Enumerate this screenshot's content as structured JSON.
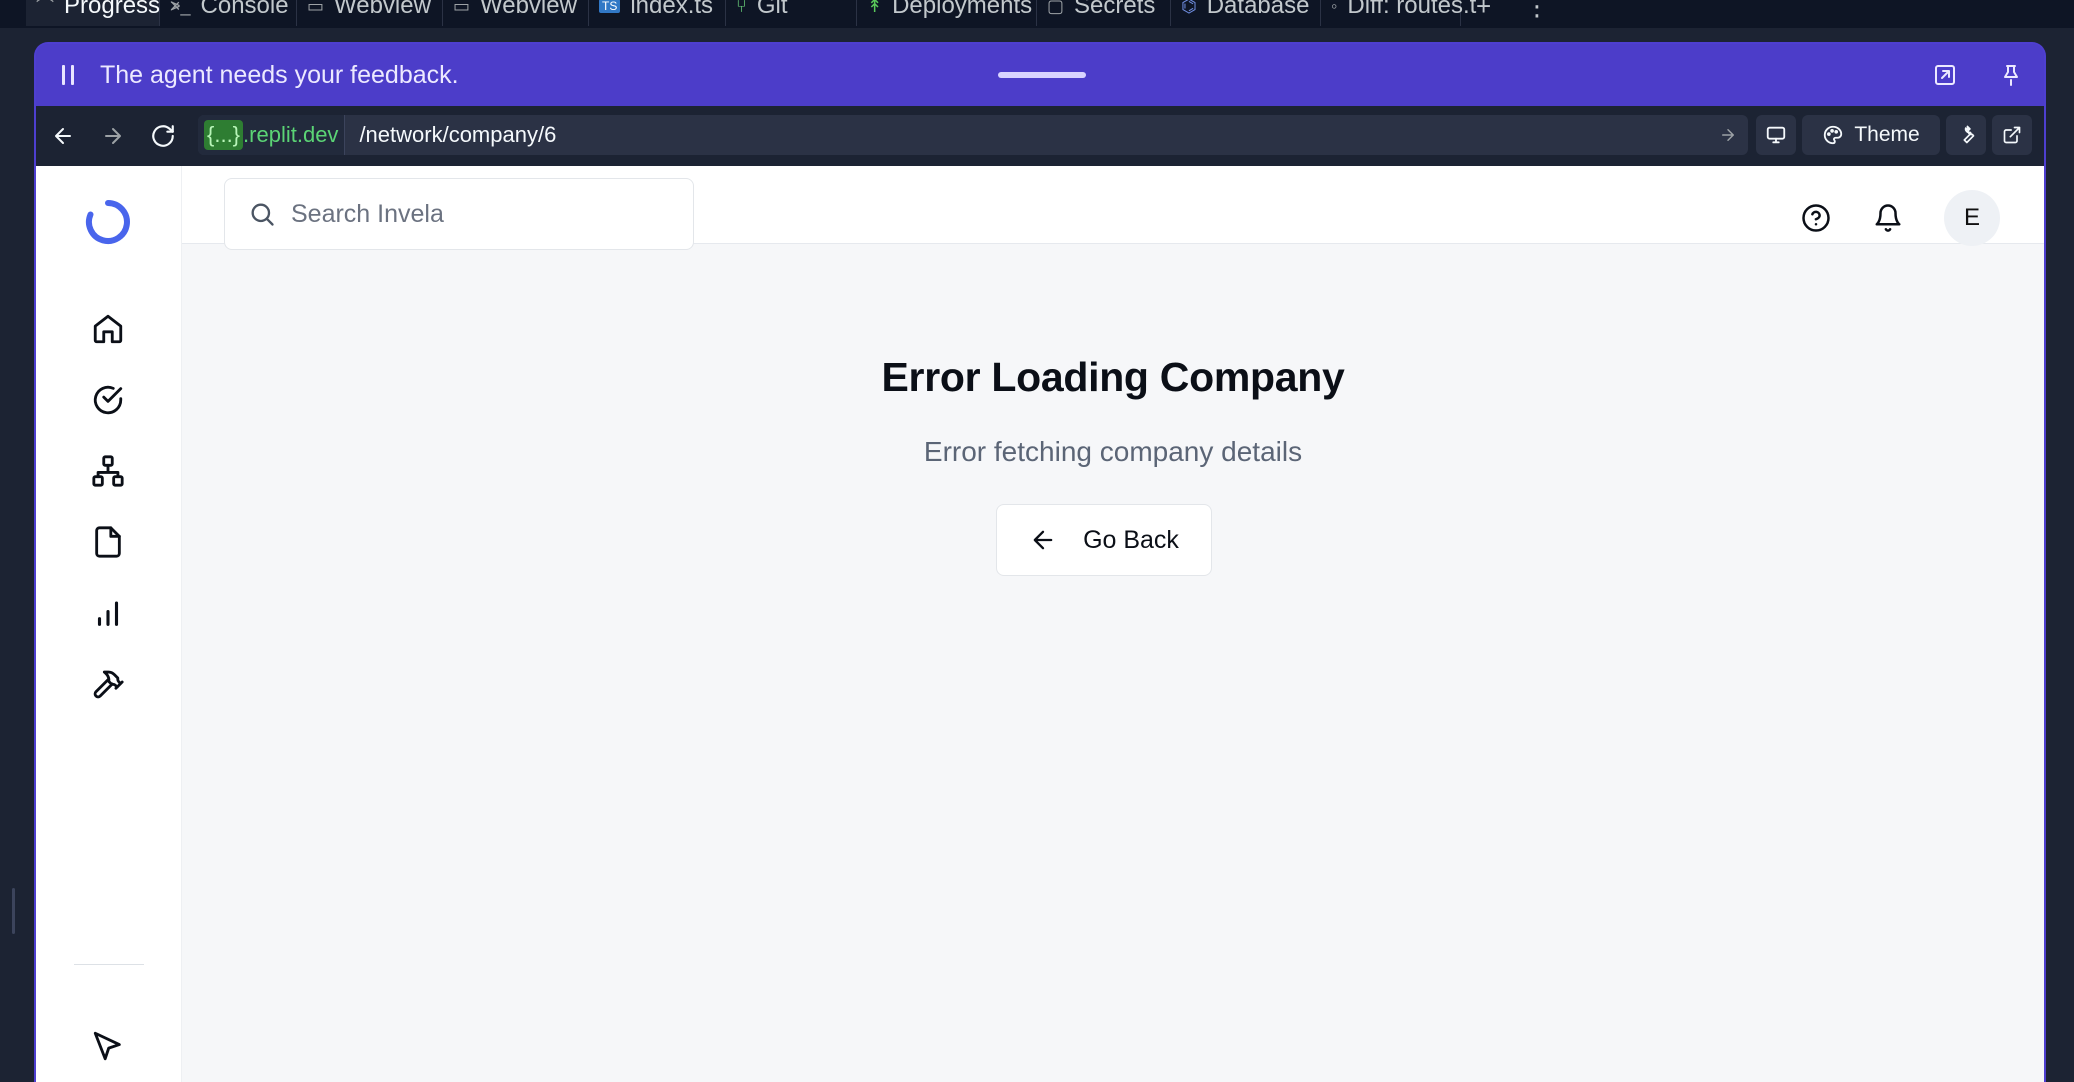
{
  "ide_tabs": [
    {
      "label": "Progress",
      "icon": "progress-icon",
      "close": "×"
    },
    {
      "label": "Console",
      "icon": "console-icon"
    },
    {
      "label": "Webview",
      "icon": "monitor-icon"
    },
    {
      "label": "Webview",
      "icon": "monitor-icon"
    },
    {
      "label": "index.ts",
      "icon": "typescript-file-icon",
      "badge": "TS"
    },
    {
      "label": "Git",
      "icon": "git-icon"
    },
    {
      "label": "Deployments",
      "icon": "deployments-icon"
    },
    {
      "label": "Secrets",
      "icon": "lock-icon"
    },
    {
      "label": "Database",
      "icon": "database-icon"
    },
    {
      "label": "Diff: routes.t",
      "icon": "diff-icon"
    }
  ],
  "feedback_bar": {
    "message": "The agent needs your feedback."
  },
  "url_bar": {
    "host_brace": "{...}",
    "host_suffix": ".replit.dev",
    "path": "/network/company/6",
    "theme_label": "Theme"
  },
  "search": {
    "placeholder": "Search Invela"
  },
  "user": {
    "initial": "E"
  },
  "error": {
    "title": "Error Loading Company",
    "message": "Error fetching company details",
    "back_label": "Go Back"
  },
  "colors": {
    "feedback_purple": "#4c3dc9",
    "brand_blue": "#4965ec",
    "url_green": "#5bd475",
    "background": "#f6f7f9"
  }
}
